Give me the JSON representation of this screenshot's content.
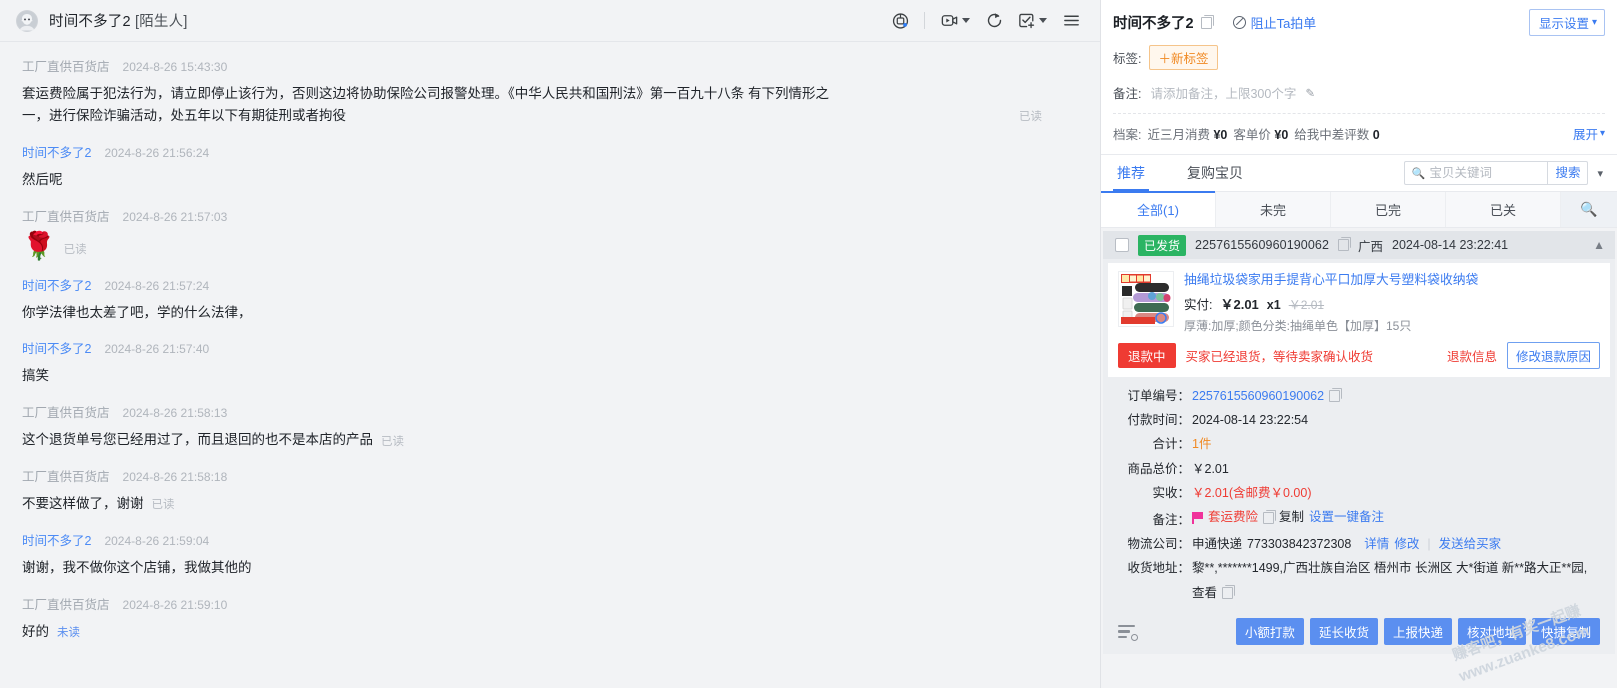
{
  "chat": {
    "header": {
      "avatar_icon": "user-avatar-icon",
      "title": "时间不多了2",
      "title_suffix": " [陌生人]",
      "tools": [
        {
          "name": "robot-assistant-icon",
          "label": "机器人"
        },
        {
          "name": "video-call-icon",
          "label": "视频"
        },
        {
          "name": "refresh-icon",
          "label": "刷新"
        },
        {
          "name": "task-add-icon",
          "label": "任务"
        },
        {
          "name": "menu-icon",
          "label": "菜单"
        }
      ]
    },
    "messages": [
      {
        "sender": "工厂直供百货店",
        "side": "seller",
        "time": "2024-8-26 15:43:30",
        "text": "套运费险属于犯法行为，请立即停止该行为，否则这边将协助保险公司报警处理。《中华人民共和国刑法》第一百九十八条 有下列情形之一，进行保险诈骗活动，处五年以下有期徒刑或者拘役",
        "status": "已读",
        "status_type": "read",
        "status_far": true
      },
      {
        "sender": "时间不多了2",
        "side": "buyer",
        "time": "2024-8-26 21:56:24",
        "text": "然后呢",
        "status": "",
        "status_type": "none"
      },
      {
        "sender": "工厂直供百货店",
        "side": "seller",
        "time": "2024-8-26 21:57:03",
        "text": "🌹",
        "is_emoji": true,
        "status": "已读",
        "status_type": "read"
      },
      {
        "sender": "时间不多了2",
        "side": "buyer",
        "time": "2024-8-26 21:57:24",
        "text": "你学法律也太差了吧，学的什么法律，",
        "status": "",
        "status_type": "none"
      },
      {
        "sender": "时间不多了2",
        "side": "buyer",
        "time": "2024-8-26 21:57:40",
        "text": "搞笑",
        "status": "",
        "status_type": "none"
      },
      {
        "sender": "工厂直供百货店",
        "side": "seller",
        "time": "2024-8-26 21:58:13",
        "text": "这个退货单号您已经用过了，而且退回的也不是本店的产品",
        "status": "已读",
        "status_type": "read"
      },
      {
        "sender": "工厂直供百货店",
        "side": "seller",
        "time": "2024-8-26 21:58:18",
        "text": "不要这样做了，谢谢",
        "status": "已读",
        "status_type": "read"
      },
      {
        "sender": "时间不多了2",
        "side": "buyer",
        "time": "2024-8-26 21:59:04",
        "text": "谢谢，我不做你这个店铺，我做其他的",
        "status": "",
        "status_type": "none"
      },
      {
        "sender": "工厂直供百货店",
        "side": "seller",
        "time": "2024-8-26 21:59:10",
        "text": "好的",
        "status": "未读",
        "status_type": "unread"
      }
    ]
  },
  "panel": {
    "customer_name": "时间不多了2",
    "copy_icon": "copy-icon",
    "block_icon": "ban-icon",
    "block_label": "阻止Ta拍单",
    "display_settings_label": "显示设置",
    "tag_label": "标签:",
    "new_tag_button": "＋新标签",
    "note_label": "备注:",
    "note_placeholder": "请添加备注，上限300个字",
    "edit_icon": "pencil-icon",
    "archive_label": "档案:",
    "archive_items": [
      {
        "label": "近三月消费",
        "value": "¥0"
      },
      {
        "label": "客单价",
        "value": "¥0"
      },
      {
        "label": "给我中差评数",
        "value": "0"
      }
    ],
    "expand_label": "展开",
    "primary_tabs": [
      {
        "label": "推荐",
        "active": true
      },
      {
        "label": "复购宝贝",
        "active": false
      }
    ],
    "search": {
      "icon": "search-icon",
      "placeholder": "宝贝关键词",
      "value": "",
      "button_label": "搜索",
      "dropdown_icon": "chevron-down-icon"
    },
    "sub_tabs": [
      {
        "label": "全部(1)",
        "active": true
      },
      {
        "label": "未完",
        "active": false
      },
      {
        "label": "已完",
        "active": false
      },
      {
        "label": "已关",
        "active": false
      }
    ],
    "sub_tab_search_icon": "search-icon"
  },
  "order": {
    "checkbox_checked": false,
    "status_badge": "已发货",
    "order_no": "2257615560960190062",
    "copy_icon": "copy-icon",
    "region": "广西",
    "created_at": "2024-08-14 23:22:41",
    "collapse_icon": "chevron-up-icon",
    "product": {
      "thumb_icon": "product-thumbnail",
      "title": "抽绳垃圾袋家用手提背心平口加厚大号塑料袋收纳袋",
      "paid_label": "实付:",
      "paid_amount": "￥2.01",
      "quantity": "x1",
      "original_price": "￥2.01",
      "spec": "厚薄:加厚;颜色分类:抽绳单色【加厚】15只"
    },
    "refund": {
      "badge": "退款中",
      "message": "买家已经退货，等待卖家确认收货",
      "info_link": "退款信息",
      "modify_button": "修改退款原因"
    },
    "details": [
      {
        "key": "订单编号",
        "value": "2257615560960190062",
        "value_style": "link",
        "copy": true
      },
      {
        "key": "付款时间",
        "value": "2024-08-14 23:22:54",
        "value_style": "plain"
      },
      {
        "key": "合计",
        "value": "1件",
        "value_style": "orange"
      },
      {
        "key": "商品总价",
        "value": "￥2.01",
        "value_style": "plain"
      },
      {
        "key": "实收",
        "value": "￥2.01(含邮费￥0.00)",
        "value_style": "red"
      }
    ],
    "remark": {
      "key": "备注",
      "flag_icon": "flag-icon",
      "text": "套运费险",
      "copy_icon": "copy-icon",
      "copy_label": "复制",
      "set_label": "设置一键备注"
    },
    "logistics": {
      "key": "物流公司",
      "company": "申通快递",
      "tracking_no": "773303842372308",
      "detail_link": "详情",
      "modify_link": "修改",
      "send_link": "发送给买家"
    },
    "address": {
      "key": "收货地址",
      "text": "黎**,*******1499,广西壮族自治区 梧州市 长洲区 大*街道 新**路大正**园,",
      "view_link": "查看",
      "copy_icon": "copy-icon"
    },
    "footer_icon": "filter-settings-icon",
    "footer_buttons": [
      "小额打款",
      "延长收货",
      "上报快递",
      "核对地址",
      "快捷复制"
    ]
  },
  "watermark": {
    "line1": "赚客吧，有奖一起赚",
    "line2": "www.zuanke8.com"
  },
  "colors": {
    "accent_blue": "#3b7bf0",
    "button_blue": "#5b8ff0",
    "success_green": "#2bb463",
    "danger_red": "#ef3b33",
    "tag_orange": "#f08a24",
    "flag_pink": "#f0329b"
  }
}
